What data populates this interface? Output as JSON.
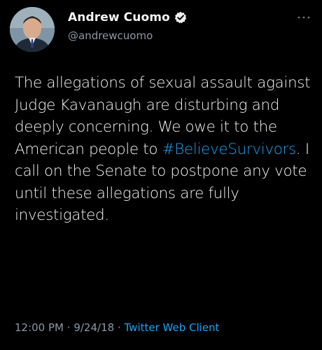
{
  "author": {
    "display_name": "Andrew Cuomo",
    "handle": "@andrewcuomo",
    "verified_icon": "verified-badge-icon",
    "avatar_icon": "profile-photo"
  },
  "more_icon": "ellipsis-icon",
  "tweet": {
    "text_part1": "The allegations of sexual assault against Judge Kavanaugh are disturbing and deeply concerning. We owe it to the American people to ",
    "hashtag": "#BelieveSurvivors",
    "text_part2": ". I call on the Senate to postpone any vote until these allegations are fully investigated."
  },
  "meta": {
    "time": "12:00 PM",
    "date": "9/24/18",
    "separator": "·",
    "client": "Twitter Web Client"
  },
  "colors": {
    "background": "#000000",
    "link": "#1da1f2",
    "secondary_text": "#8b98a5",
    "primary_text": "#f2f2f2"
  }
}
